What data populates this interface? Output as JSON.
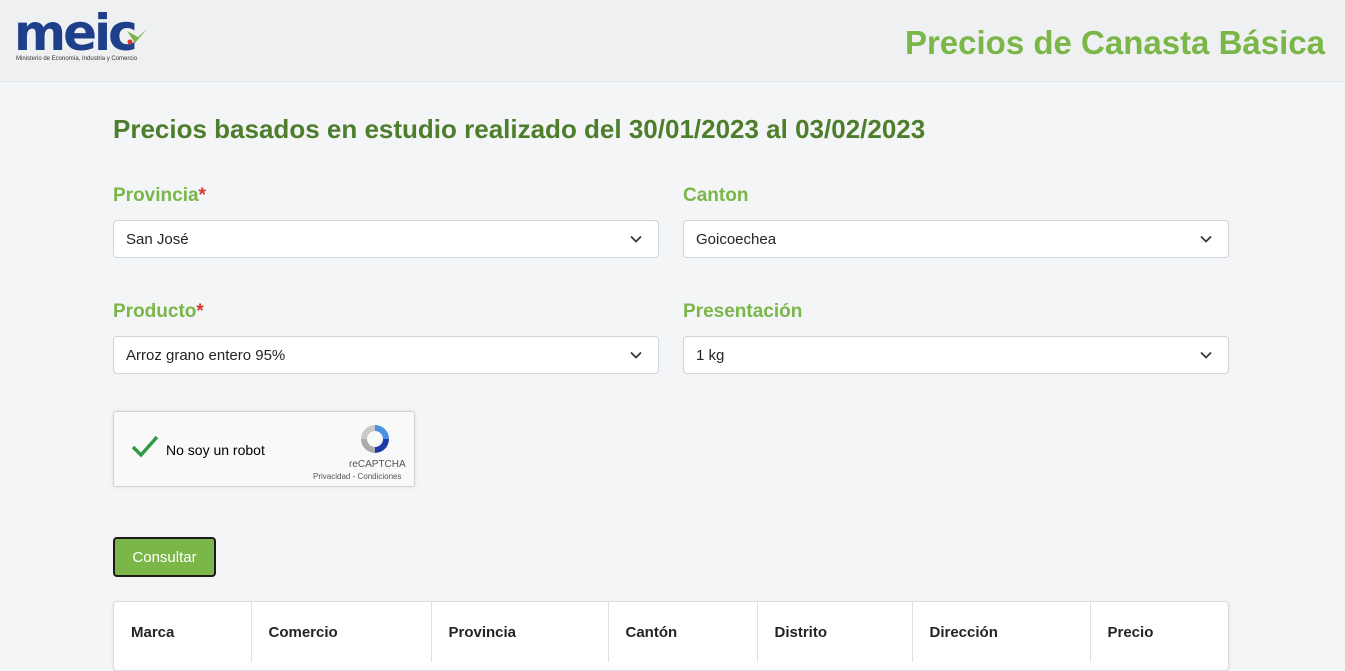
{
  "header": {
    "logo_text": "meic",
    "logo_subtitle": "Ministerio de Economía, Industria y Comercio",
    "app_title": "Precios de Canasta Básica"
  },
  "main": {
    "study_title": "Precios basados en estudio realizado del 30/01/2023 al 03/02/2023"
  },
  "form": {
    "required_mark": "*",
    "provincia": {
      "label": "Provincia",
      "value": "San José"
    },
    "canton": {
      "label": "Canton",
      "value": "Goicoechea"
    },
    "producto": {
      "label": "Producto",
      "value": "Arroz grano entero 95%"
    },
    "presentacion": {
      "label": "Presentación",
      "value": "1 kg"
    }
  },
  "recaptcha": {
    "label": "No soy un robot",
    "brand": "reCAPTCHA",
    "links": "Privacidad - Condiciones",
    "checked": true
  },
  "actions": {
    "consultar_label": "Consultar"
  },
  "table": {
    "headers": [
      "Marca",
      "Comercio",
      "Provincia",
      "Cantón",
      "Distrito",
      "Dirección",
      "Precio"
    ]
  },
  "colors": {
    "accent_green": "#7ab648",
    "dark_green": "#4e7d2c",
    "brand_blue": "#1e3f8a",
    "required_red": "#d9342b"
  },
  "icons": {
    "select_arrow": "chevron-down-icon",
    "checkbox": "checkmark-icon",
    "captcha_logo": "recaptcha-logo-icon"
  }
}
